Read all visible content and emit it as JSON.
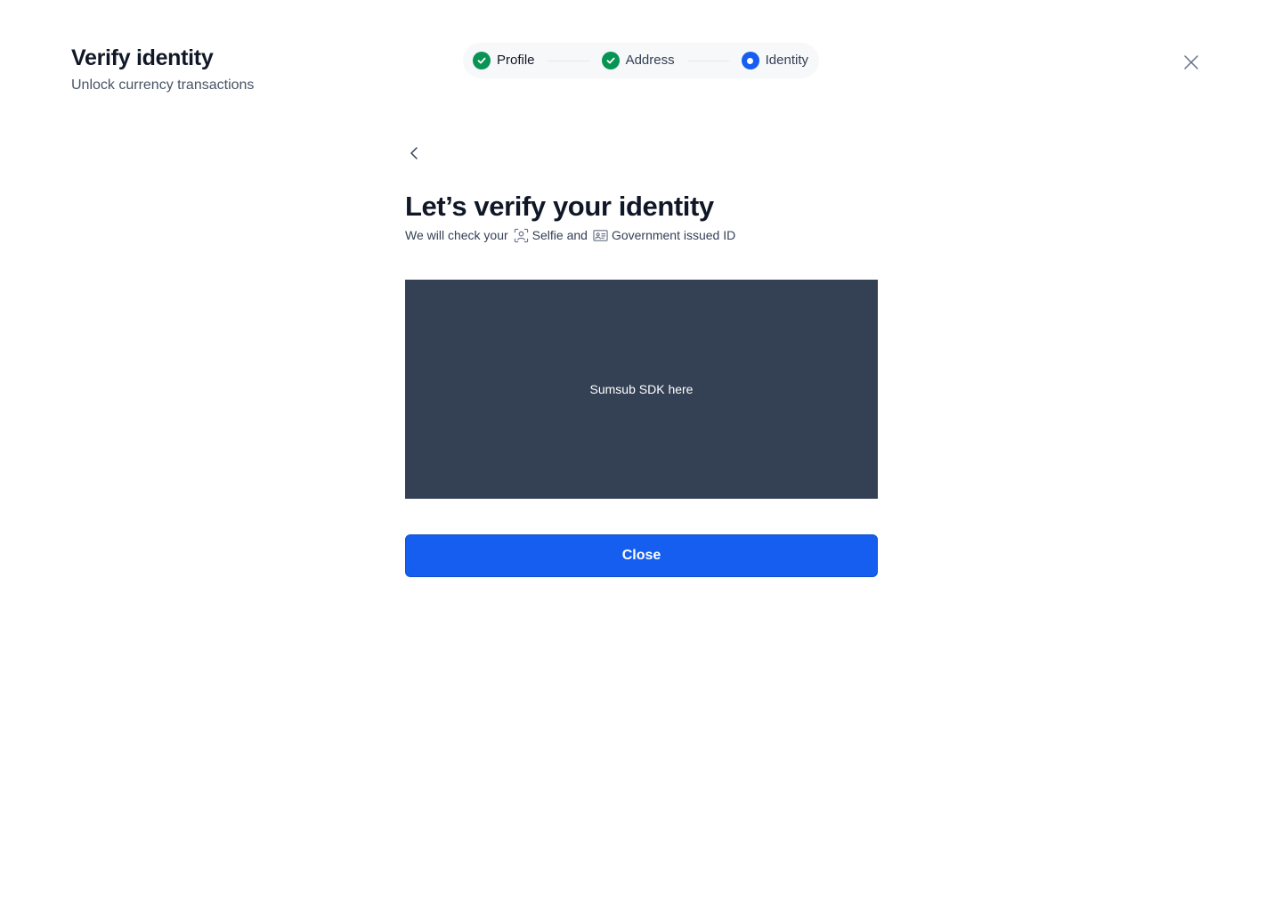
{
  "header": {
    "title": "Verify identity",
    "subtitle": "Unlock currency transactions"
  },
  "stepper": {
    "steps": [
      {
        "label": "Profile",
        "status": "complete"
      },
      {
        "label": "Address",
        "status": "complete"
      },
      {
        "label": "Identity",
        "status": "current"
      }
    ]
  },
  "main": {
    "title": "Let’s verify your identity",
    "desc_prefix": "We will check your",
    "selfie_label": "Selfie and",
    "id_label": "Government issued ID",
    "sdk_placeholder": "Sumsub SDK here",
    "close_label": "Close"
  },
  "icons": {
    "close": "close-icon",
    "back": "chevron-left-icon",
    "selfie": "face-scan-icon",
    "id": "id-card-icon",
    "check": "check-icon"
  },
  "colors": {
    "accent": "#155eef",
    "success": "#079455",
    "sdk_background": "#344054",
    "text_primary": "#101828",
    "text_secondary": "#475467"
  }
}
